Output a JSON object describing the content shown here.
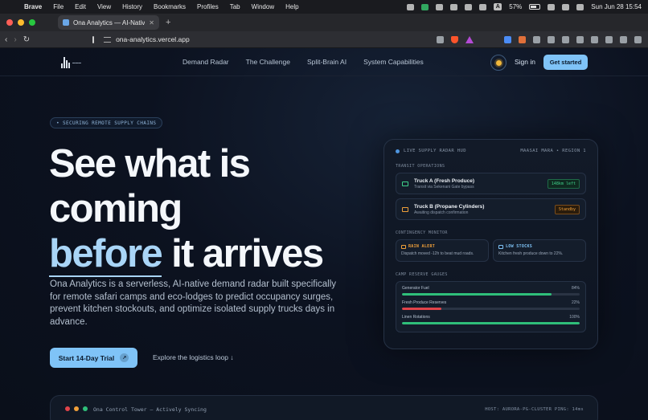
{
  "menubar": {
    "app": "Brave",
    "items": [
      "File",
      "Edit",
      "View",
      "History",
      "Bookmarks",
      "Profiles",
      "Tab",
      "Window",
      "Help"
    ],
    "battery": "57%",
    "a_key": "A",
    "datetime": "Sun Jun 28  15:54"
  },
  "browser": {
    "tab_title": "Ona Analytics — AI-Native De",
    "url": "ona-analytics.vercel.app"
  },
  "site": {
    "nav": [
      "Demand Radar",
      "The Challenge",
      "Split-Brain AI",
      "System Capabilities"
    ],
    "signin": "Sign in",
    "get_started": "Get started",
    "pill": "• SECURING REMOTE SUPPLY CHAINS",
    "headline": {
      "line1": "See what is",
      "line2": "coming",
      "highlight": "before",
      "rest": "it arrives"
    },
    "lead": "Ona Analytics is a serverless, AI-native demand radar built specifically for remote safari camps and eco-lodges to predict occupancy surges, prevent kitchen stockouts, and optimize isolated supply trucks days in advance.",
    "cta": "Start 14-Day Trial",
    "cta_arrow": "↗",
    "explore": "Explore the logistics loop ↓"
  },
  "hud": {
    "title": "LIVE SUPPLY RADAR HUD",
    "region": "MAASAI MARA • REGION 1",
    "transit_label": "TRANSIT OPERATIONS",
    "trucks": [
      {
        "name": "Truck A (Fresh Produce)",
        "sub": "Transit via Sekenani Gate bypass",
        "badge": "148km left",
        "color": "#3fd08a"
      },
      {
        "name": "Truck B (Propane Cylinders)",
        "sub": "Awaiting dispatch confirmation",
        "badge": "Standby",
        "color": "#f0a03a"
      }
    ],
    "contingency_label": "CONTINGENCY MONITOR",
    "alerts": [
      {
        "title": "RAIN ALERT",
        "sub": "Dispatch moved -12h to beat mud roads.",
        "color": "#f0a03a"
      },
      {
        "title": "LOW STOCKS",
        "sub": "Kitchen fresh produce down to 22%.",
        "color": "#7fc3f7"
      }
    ],
    "gauges_label": "CAMP RESERVE GAUGES",
    "gauges": [
      {
        "name": "Generator Fuel",
        "pct": "84%",
        "value": 0.84,
        "color": "#2fbf7a"
      },
      {
        "name": "Fresh Produce Reserves",
        "pct": "22%",
        "value": 0.22,
        "color": "#e0444a"
      },
      {
        "name": "Linen Rotations",
        "pct": "100%",
        "value": 1.0,
        "color": "#2fbf7a"
      }
    ]
  },
  "tower": {
    "title": "Ona Control Tower — Actively Syncing",
    "host": "HOST: AURORA-PG-CLUSTER  PING: 14ms"
  }
}
